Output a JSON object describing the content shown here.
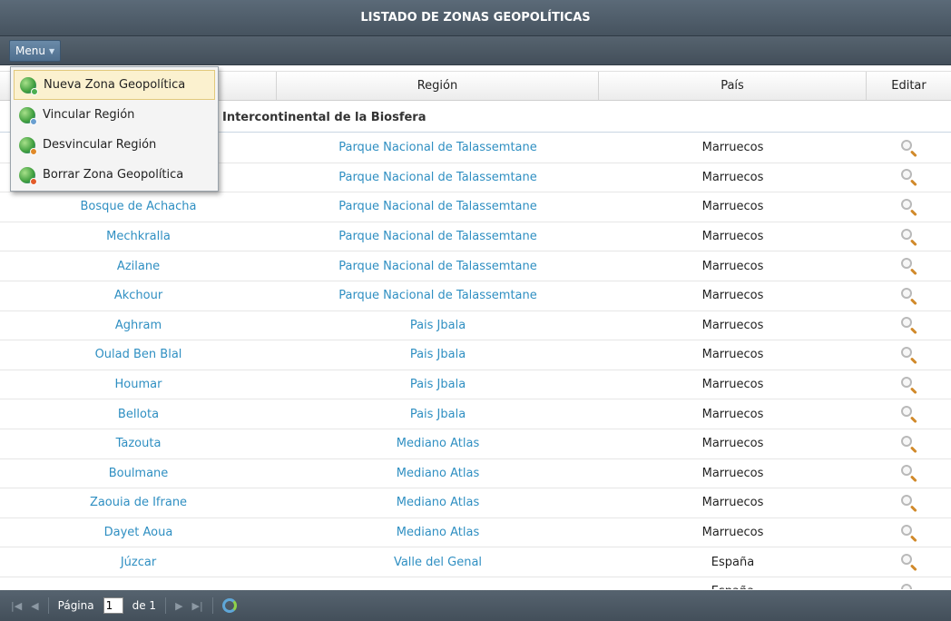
{
  "window": {
    "title": "LISTADO DE ZONAS GEOPOLÍTICAS"
  },
  "toolbar": {
    "menu_label": "Menu"
  },
  "menu": {
    "items": [
      {
        "label": "Nueva Zona Geopolítica",
        "icon": "globe-add-icon",
        "badge_color": "#4caf50"
      },
      {
        "label": "Vincular Región",
        "icon": "globe-link-icon",
        "badge_color": "#6a9fd0"
      },
      {
        "label": "Desvincular Región",
        "icon": "globe-unlink-icon",
        "badge_color": "#e08a2a"
      },
      {
        "label": "Borrar Zona Geopolítica",
        "icon": "globe-delete-icon",
        "badge_color": "#e35b2a"
      }
    ]
  },
  "grid": {
    "columns": [
      {
        "label": ""
      },
      {
        "label": "Región"
      },
      {
        "label": "País"
      },
      {
        "label": "Editar"
      }
    ],
    "group_label": "Intercontinental de la Biosfera",
    "rows": [
      {
        "zone": "",
        "region": "Parque Nacional de Talassemtane",
        "country": "Marruecos"
      },
      {
        "zone": "",
        "region": "Parque Nacional de Talassemtane",
        "country": "Marruecos"
      },
      {
        "zone": "Bosque de Achacha",
        "region": "Parque Nacional de Talassemtane",
        "country": "Marruecos"
      },
      {
        "zone": "Mechkralla",
        "region": "Parque Nacional de Talassemtane",
        "country": "Marruecos"
      },
      {
        "zone": "Azilane",
        "region": "Parque Nacional de Talassemtane",
        "country": "Marruecos"
      },
      {
        "zone": "Akchour",
        "region": "Parque Nacional de Talassemtane",
        "country": "Marruecos"
      },
      {
        "zone": "Aghram",
        "region": "Pais Jbala",
        "country": "Marruecos"
      },
      {
        "zone": "Oulad Ben Blal",
        "region": "Pais Jbala",
        "country": "Marruecos"
      },
      {
        "zone": "Houmar",
        "region": "Pais Jbala",
        "country": "Marruecos"
      },
      {
        "zone": "Bellota",
        "region": "Pais Jbala",
        "country": "Marruecos"
      },
      {
        "zone": "Tazouta",
        "region": "Mediano Atlas",
        "country": "Marruecos"
      },
      {
        "zone": "Boulmane",
        "region": "Mediano Atlas",
        "country": "Marruecos"
      },
      {
        "zone": "Zaouia de Ifrane",
        "region": "Mediano Atlas",
        "country": "Marruecos"
      },
      {
        "zone": "Dayet Aoua",
        "region": "Mediano Atlas",
        "country": "Marruecos"
      },
      {
        "zone": "Júzcar",
        "region": "Valle del Genal",
        "country": "España"
      },
      {
        "zone": "",
        "region": "",
        "country": "España"
      }
    ]
  },
  "pager": {
    "page_label": "Página",
    "page_value": "1",
    "of_label": "de 1"
  },
  "colors": {
    "link": "#2f8fc2",
    "titlebar": "#4f5c68"
  }
}
